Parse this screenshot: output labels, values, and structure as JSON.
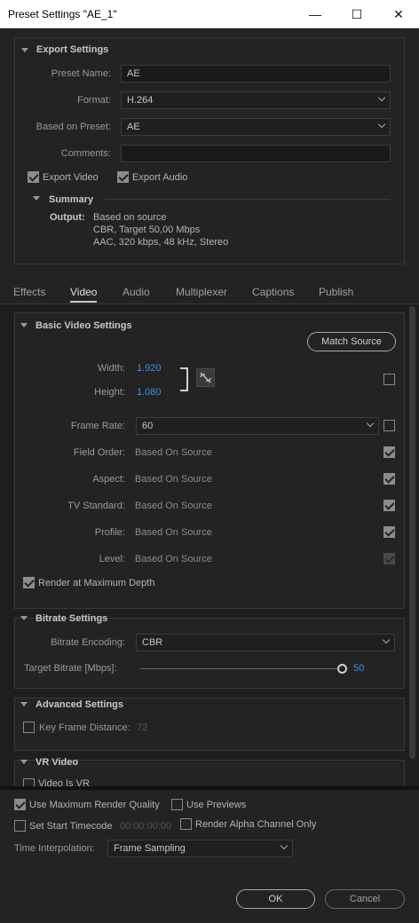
{
  "window": {
    "title": "Preset Settings \"AE_1\"",
    "minimize": "—",
    "maximize": "☐",
    "close": "✕"
  },
  "export": {
    "section_title": "Export Settings",
    "preset_name_label": "Preset Name:",
    "preset_name": "AE",
    "format_label": "Format:",
    "format": "H.264",
    "based_on_label": "Based on Preset:",
    "based_on": "AE",
    "comments_label": "Comments:",
    "comments": "",
    "export_video": "Export Video",
    "export_audio": "Export Audio",
    "summary_title": "Summary",
    "output_label": "Output:",
    "output_lines": [
      "Based on source",
      "CBR, Target 50,00 Mbps",
      "AAC, 320 kbps, 48 kHz, Stereo"
    ]
  },
  "tabs": [
    "Effects",
    "Video",
    "Audio",
    "Multiplexer",
    "Captions",
    "Publish"
  ],
  "active_tab": "Video",
  "video": {
    "section_title": "Basic Video Settings",
    "match_source": "Match Source",
    "width_label": "Width:",
    "width": "1.920",
    "height_label": "Height:",
    "height": "1.080",
    "frame_rate_label": "Frame Rate:",
    "frame_rate": "60",
    "field_order_label": "Field Order:",
    "field_order": "Based On Source",
    "aspect_label": "Aspect:",
    "aspect": "Based On Source",
    "tv_standard_label": "TV Standard:",
    "tv_standard": "Based On Source",
    "profile_label": "Profile:",
    "profile": "Based On Source",
    "level_label": "Level:",
    "level": "Based On Source",
    "render_max_depth": "Render at Maximum Depth"
  },
  "bitrate": {
    "section_title": "Bitrate Settings",
    "encoding_label": "Bitrate Encoding:",
    "encoding": "CBR",
    "target_label": "Target Bitrate [Mbps]:",
    "target": "50",
    "target_fraction": 1.0
  },
  "advanced": {
    "section_title": "Advanced Settings",
    "key_frame_label": "Key Frame Distance:",
    "key_frame": "72"
  },
  "vr": {
    "section_title": "VR Video",
    "video_is_vr": "Video Is VR"
  },
  "bottom": {
    "max_render_quality": "Use Maximum Render Quality",
    "use_previews": "Use Previews",
    "set_start_timecode": "Set Start Timecode",
    "timecode": "00:00:00:00",
    "render_alpha": "Render Alpha Channel Only",
    "time_interp_label": "Time Interpolation:",
    "time_interp": "Frame Sampling",
    "ok": "OK",
    "cancel": "Cancel"
  }
}
